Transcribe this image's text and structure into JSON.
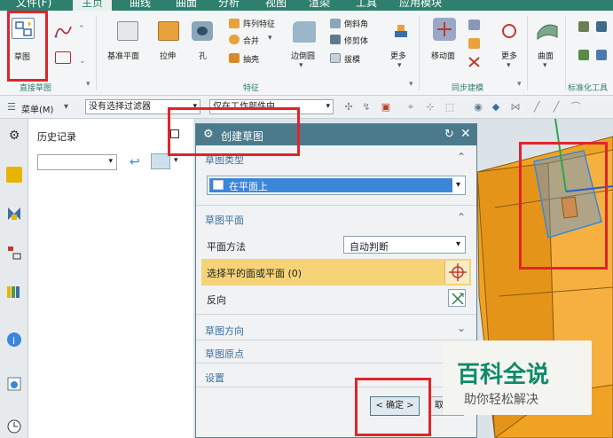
{
  "menu": {
    "items": [
      "文件(F)",
      "主页",
      "曲线",
      "曲面",
      "分析",
      "视图",
      "渲染",
      "工具",
      "应用模块"
    ]
  },
  "ribbon": {
    "sketch_group": {
      "label": "直接草图",
      "sketch_button": "草图"
    },
    "feature_group": {
      "label": "特征",
      "buttons": [
        "基准平面",
        "拉伸",
        "孔",
        "阵列特征",
        "合并",
        "抽壳",
        "边倒圆",
        "倒斜角",
        "修剪体",
        "拔模",
        "更多"
      ]
    },
    "sync_group": {
      "label": "同步建模",
      "buttons": [
        "移动面",
        "更多"
      ]
    },
    "surface_group": {
      "buttons": [
        "曲面"
      ]
    },
    "standard_group": {
      "label": "标准化工具"
    }
  },
  "toolbar": {
    "menu_label": "菜单(M)",
    "filter_value": "没有选择过滤器",
    "scope_value": "仅在工作部件中"
  },
  "history": {
    "title": "历史记录"
  },
  "dialog": {
    "title": "创建草图",
    "sketch_type_label": "草图类型",
    "sketch_type_value": "在平面上",
    "sketch_plane_label": "草图平面",
    "plane_method_label": "平面方法",
    "plane_method_value": "自动判断",
    "select_face_label": "选择平的面或平面 (0)",
    "reverse_label": "反向",
    "sketch_dir_label": "草图方向",
    "sketch_origin_label": "草图原点",
    "settings_label": "设置",
    "ok_label": "< 确定 >",
    "cancel_label": "取"
  },
  "watermark": {
    "line1": "百科全说",
    "line2": "助你轻松解决"
  },
  "colors": {
    "accent": "#2f7f6e",
    "dialog_title": "#4a7a8c",
    "highlight": "#f5d376",
    "selection": "#3b86d9",
    "annotation": "#e0242a",
    "model": "#f0a322"
  }
}
